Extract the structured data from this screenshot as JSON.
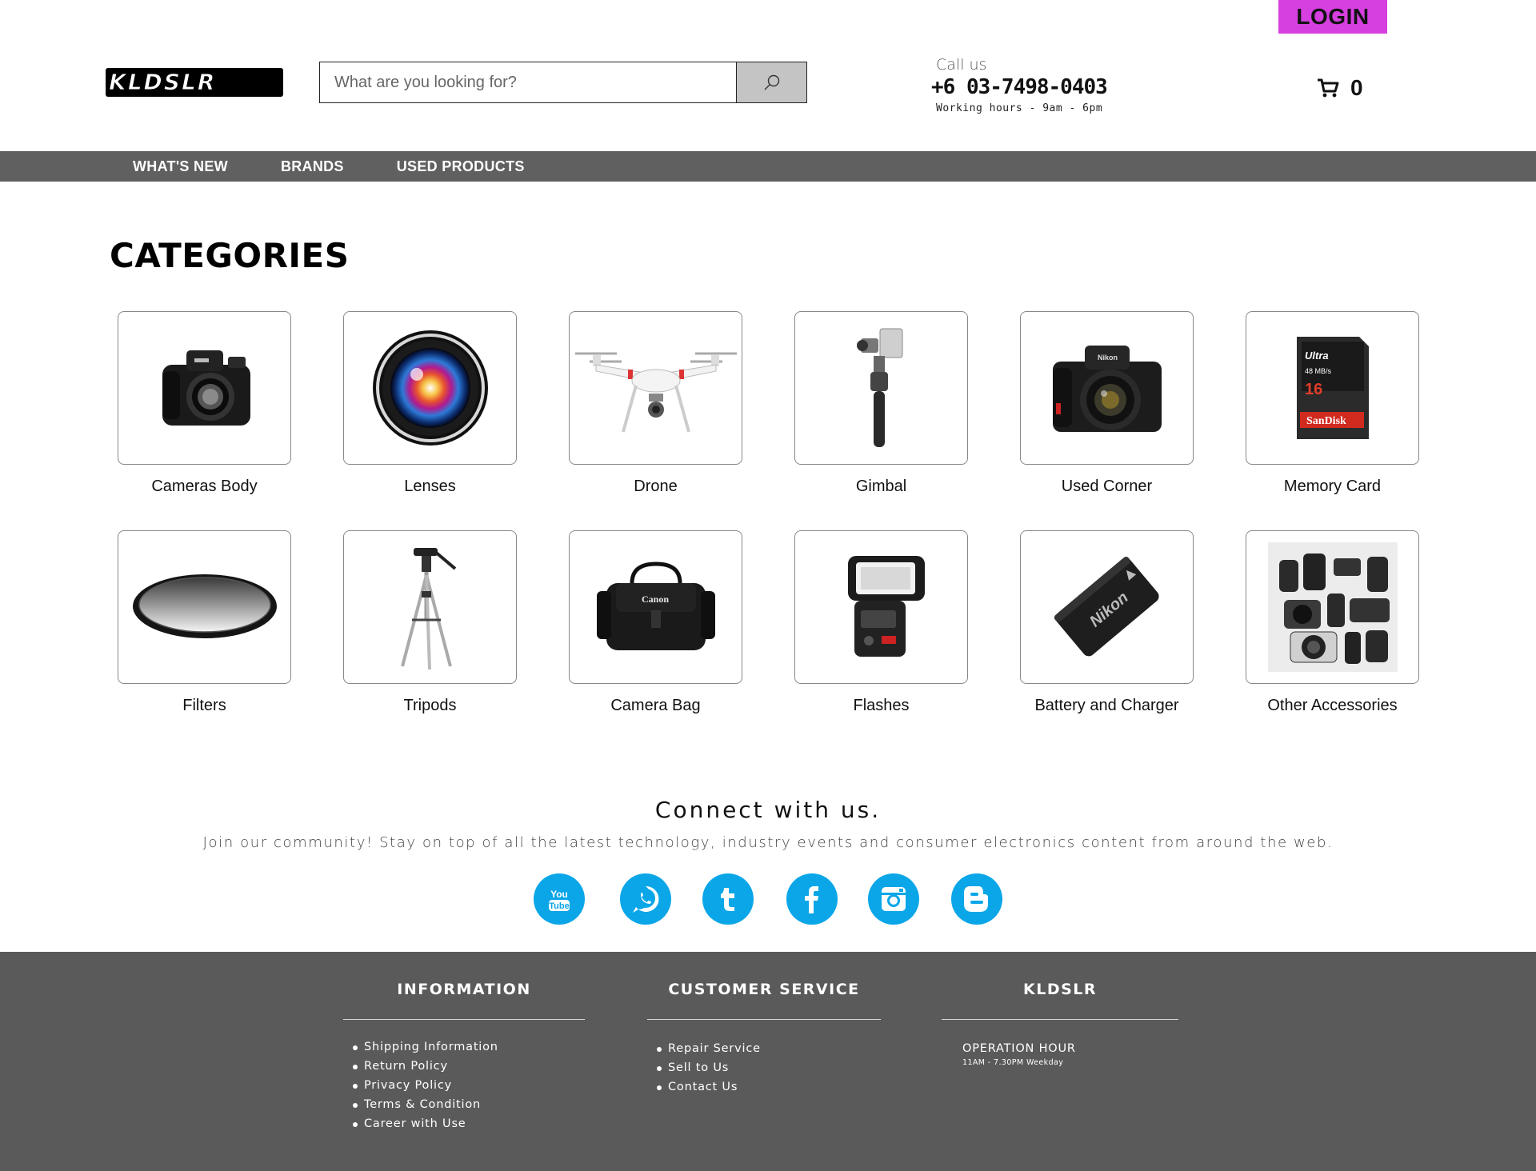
{
  "header": {
    "login_label": "LOGIN",
    "logo_text": "KLDSLR",
    "search_placeholder": "What are you looking for?",
    "call_label": "Call us",
    "phone": "+6 03-7498-0403",
    "hours": "Working hours - 9am - 6pm",
    "cart_count": "0"
  },
  "nav": {
    "items": [
      "WHAT'S NEW",
      "BRANDS",
      "USED PRODUCTS"
    ]
  },
  "categories": {
    "title": "CATEGORIES",
    "items": [
      {
        "label": "Cameras Body",
        "icon": "camera-body-icon"
      },
      {
        "label": "Lenses",
        "icon": "lens-icon"
      },
      {
        "label": "Drone",
        "icon": "drone-icon"
      },
      {
        "label": "Gimbal",
        "icon": "gimbal-icon"
      },
      {
        "label": "Used Corner",
        "icon": "used-camera-icon"
      },
      {
        "label": "Memory Card",
        "icon": "memory-card-icon"
      },
      {
        "label": "Filters",
        "icon": "filter-icon"
      },
      {
        "label": "Tripods",
        "icon": "tripod-icon"
      },
      {
        "label": "Camera Bag",
        "icon": "camera-bag-icon"
      },
      {
        "label": "Flashes",
        "icon": "flash-icon"
      },
      {
        "label": "Battery and Charger",
        "icon": "battery-icon"
      },
      {
        "label": "Other Accessories",
        "icon": "accessories-icon"
      }
    ],
    "image_text": {
      "memory_card_brand": "Ultra",
      "memory_card_speed": "48 MB/s",
      "memory_card_capacity": "16",
      "memory_card_maker": "SanDisk",
      "bag_brand": "Canon",
      "battery_brand": "Nikon",
      "camera_brand": "Nikon"
    }
  },
  "connect": {
    "title": "Connect with us.",
    "subtitle": "Join our community! Stay on top of all the latest technology, industry events and consumer electronics content from around the web.",
    "socials": [
      "youtube-icon",
      "whatsapp-icon",
      "tumblr-icon",
      "facebook-icon",
      "instagram-icon",
      "blogger-icon"
    ]
  },
  "footer": {
    "information": {
      "title": "INFORMATION",
      "links": [
        "Shipping Information",
        "Return Policy",
        "Privacy Policy",
        "Terms & Condition",
        "Career with Use"
      ]
    },
    "customer_service": {
      "title": "CUSTOMER SERVICE",
      "links": [
        "Repair Service",
        "Sell to Us",
        "Contact Us"
      ]
    },
    "kldslr": {
      "title": "KLDSLR",
      "operation_title": "OPERATION HOUR",
      "operation_hours": "11AM - 7.30PM  Weekday"
    }
  },
  "colors": {
    "login_bg": "#d63fe0",
    "nav_bg": "#606060",
    "footer_bg": "#5a5a5a",
    "social_blue": "#0aa6e8"
  }
}
